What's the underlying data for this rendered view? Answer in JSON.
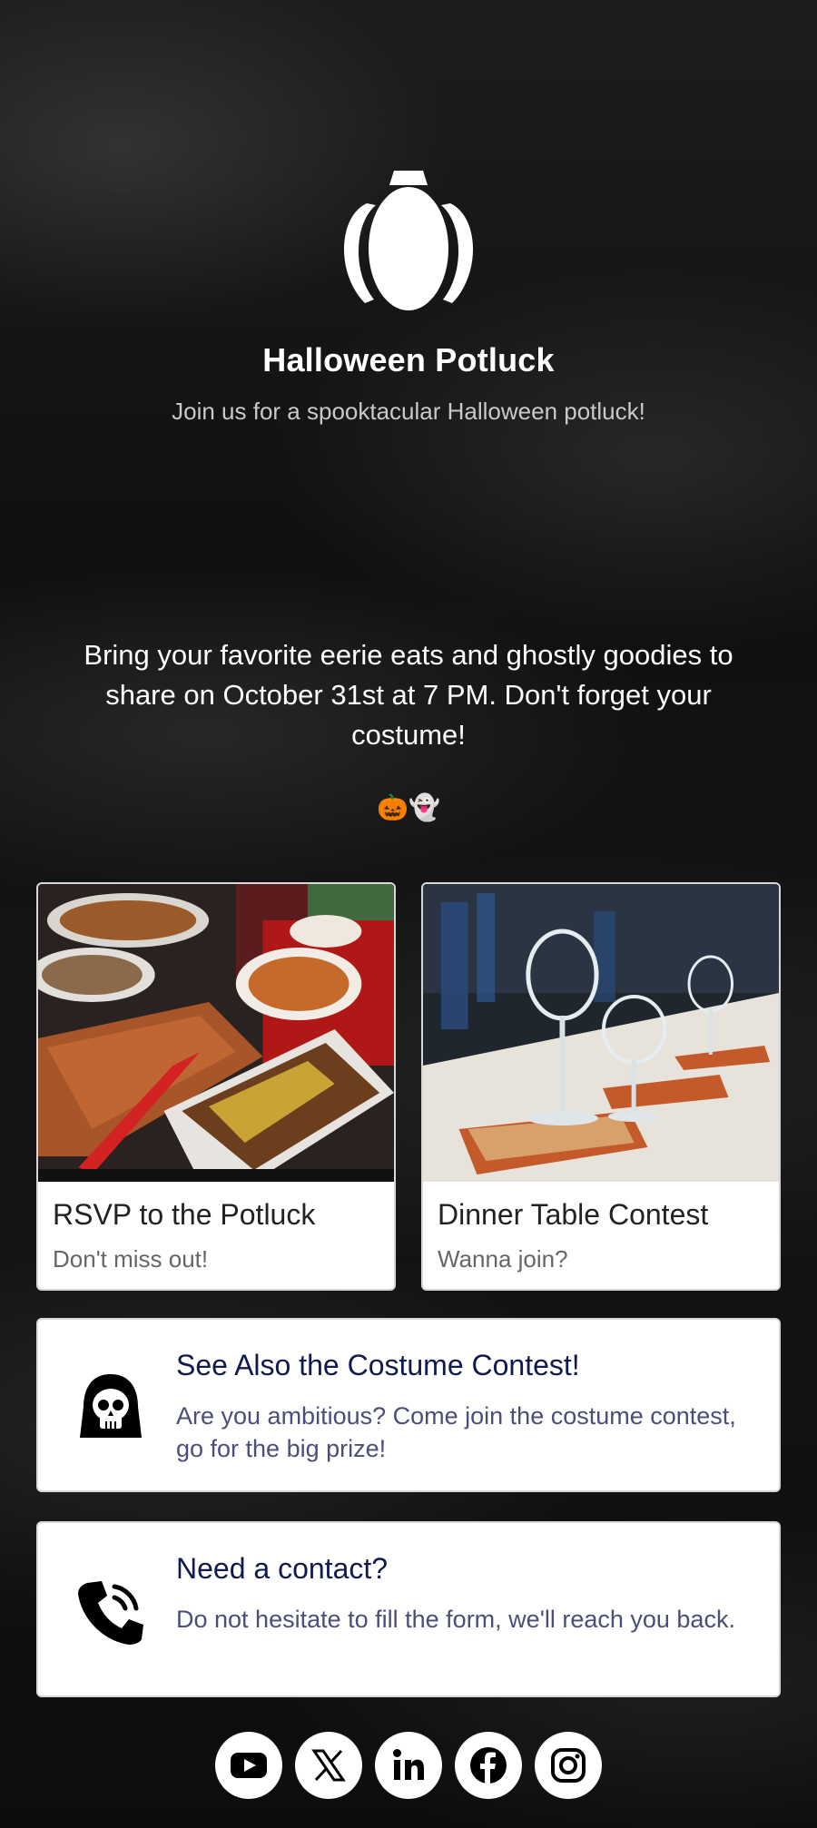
{
  "header": {
    "title": "Halloween Potluck",
    "subtitle": "Join us for a spooktacular Halloween potluck!"
  },
  "description": "Bring your favorite eerie eats and ghostly goodies to share on October 31st at 7 PM. Don't forget your costume!",
  "emoji_line": "🎃👻",
  "cards": [
    {
      "title": "RSVP to the Potluck",
      "subtitle": "Don't miss out!",
      "image": "potluck-food-photo"
    },
    {
      "title": "Dinner Table Contest",
      "subtitle": "Wanna join?",
      "image": "dinner-table-photo"
    }
  ],
  "info_cards": [
    {
      "icon": "ghost-skull-icon",
      "title": "See Also the Costume Contest!",
      "text": "Are you ambitious? Come join the costume contest, go for the big prize!"
    },
    {
      "icon": "phone-call-icon",
      "title": "Need a contact?",
      "text": "Do not hesitate to fill the form, we'll reach you back."
    }
  ],
  "socials": [
    "youtube-icon",
    "x-icon",
    "linkedin-icon",
    "facebook-icon",
    "instagram-icon"
  ],
  "colors": {
    "card_title": "#111a4f",
    "card_text": "#4b4e79",
    "background": "#0b0b0b"
  }
}
